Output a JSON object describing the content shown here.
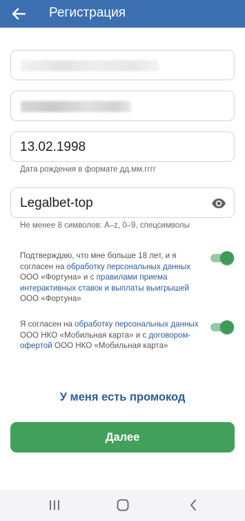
{
  "header": {
    "title": "Регистрация",
    "back_icon": "arrow-left-icon",
    "background": "#3b6fb0"
  },
  "form": {
    "birth_date": {
      "value": "13.02.1998",
      "hint": "Дата рождения в формате дд.мм.гггг"
    },
    "password": {
      "value": "Legalbet-top",
      "hint": "Не менее 8 символов: A–z, 0–9, спецсимволы",
      "visibility_icon": "eye-icon"
    }
  },
  "consents": [
    {
      "parts": [
        {
          "text": "Подтверждаю, что мне больше 18 лет, и я согласен на "
        },
        {
          "text": "обработку персональных данных",
          "link": true
        },
        {
          "text": " ООО «Фортуна» и с "
        },
        {
          "text": "правилами приема интерактивных ставок и выплаты выигрышей",
          "link": true
        },
        {
          "text": " ООО «Фортуна»"
        }
      ],
      "checked": true
    },
    {
      "parts": [
        {
          "text": "Я согласен на "
        },
        {
          "text": "обработку персональных данных",
          "link": true
        },
        {
          "text": " ООО НКО «Мобильная карта» и с "
        },
        {
          "text": "договором-офертой",
          "link": true
        },
        {
          "text": " ООО НКО «Мобильная карта»"
        }
      ],
      "checked": true
    }
  ],
  "promo_link": "У меня есть промокод",
  "next_button": "Далее",
  "navbar": {
    "recents_icon": "recents-icon",
    "home_icon": "home-icon",
    "back_icon": "nav-back-icon"
  },
  "colors": {
    "accent": "#43a05c",
    "link": "#2c5c9a",
    "toggle_on": "#3e9a56"
  }
}
